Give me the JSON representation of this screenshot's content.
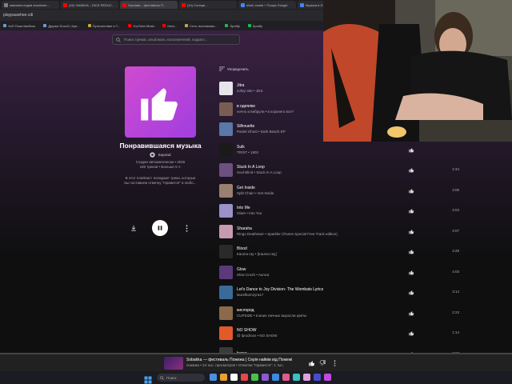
{
  "browser": {
    "tabs": [
      {
        "label": "ованием лидов значение...",
        "color": "#7f7f86"
      },
      {
        "label": "(16) YAMAHA – DICE REDUCT...",
        "color": "#ff0000"
      },
      {
        "label": "Hondata – фестиваль П...",
        "color": "#ff0000"
      },
      {
        "label": "(14) Солнце...",
        "color": "#ff0000"
      },
      {
        "label": "whaf–ткаев + Пошук Google",
        "color": "#4285f4"
      },
      {
        "label": "Музыка в Google dve Wahan...",
        "color": "#4285f4"
      },
      {
        "label": "Вечер...",
        "color": "#7f7f86"
      }
    ],
    "url": "playpauwhee.cdi",
    "bookmarks": [
      {
        "label": "УаП Пошт.Шаблон",
        "color": "#6b9bd1"
      },
      {
        "label": "Друзья Dnoo3 | Кри...",
        "color": "#6b9bd1"
      },
      {
        "label": "Путешествие в Т...",
        "color": "#c9a14a"
      },
      {
        "label": "YouTube Music",
        "color": "#ff0000"
      },
      {
        "label": "Ham...",
        "color": "#ff0000"
      },
      {
        "label": "Сеть: виставляю...",
        "color": "#c9a14a"
      },
      {
        "label": "Spotify",
        "color": "#1db954"
      },
      {
        "label": "Spotify",
        "color": "#1db954"
      }
    ]
  },
  "search": {
    "placeholder": "Поиск треков, альбомов, исполнителей, подкаст..."
  },
  "playlist": {
    "title": "Понравившаяся музыка",
    "owner": "Sayviod",
    "meta_line1": "Создан автоматически • 2026",
    "meta_line2": "180 треков • Больше 5 ч.",
    "desc_line1": "В этот плейлист попадают треки, которые",
    "desc_line2": "вы поставили отметку \"Нравится\" в любо..."
  },
  "sort_label": "Упорядочить",
  "tracks": [
    {
      "title": "Jitra",
      "sub": "sofsyi site • Jitra",
      "duration": "",
      "thumb": "#e5e5ea"
    },
    {
      "title": "в одеялке",
      "sub": "ночно и вибрули • в корзинго все?",
      "duration": "",
      "thumb": "#7a5d52"
    },
    {
      "title": "Silhouette",
      "sub": "Pastel Ghost • Dark Beach EP",
      "duration": "",
      "thumb": "#5a78a8"
    },
    {
      "title": "Sulk",
      "sub": "TR/ST • 1802",
      "duration": "",
      "thumb": "#1a1a1a"
    },
    {
      "title": "Stuck In A Loop",
      "sub": "Soul Blind • Stuck In A Loop",
      "duration": "2:34",
      "thumb": "#6b5080"
    },
    {
      "title": "Get Inside",
      "sub": "Split Chain • Get Inside",
      "duration": "3:05",
      "thumb": "#9a8070"
    },
    {
      "title": "Into Me",
      "sub": "Glare • Into You",
      "duration": "2:04",
      "thumb": "#9a92c8"
    },
    {
      "title": "Sharaha",
      "sub": "Ringo Deathstarr • Sparkler (iTunes Special Free Track edition)",
      "duration": "2:07",
      "thumb": "#c89ab0"
    },
    {
      "title": "Blood",
      "sub": "trauma ray • [trauma ray]",
      "duration": "4:28",
      "thumb": "#2a2a2a"
    },
    {
      "title": "Glow",
      "sub": "Slow Crush • Aurora",
      "duration": "4:03",
      "thumb": "#5a3a7a"
    },
    {
      "title": "Let's Dance to Joy Division- The Wombats Lyrics",
      "sub": "laurelbomzyra17",
      "duration": "3:14",
      "thumb": "#3a6a9a"
    },
    {
      "title": "кислород",
      "sub": "CUPSIZE • в моих личных выросли цветы",
      "duration": "2:23",
      "thumb": "#8a6a4a"
    },
    {
      "title": "NO SHOW",
      "sub": "@ lprodroxs • NO SHOW",
      "duration": "1:14",
      "thumb": "#e05a2a"
    },
    {
      "title": "hyper",
      "sub": "",
      "duration": "2:07",
      "thumb": "#3a3a3a"
    }
  ],
  "now_playing": {
    "title": "Sobakka — фестиваль Пожежа | Серія найвів від Пожежі",
    "sub": "пожежа • 24 тыс. просмотров • Отметки \"Нравится\": 1 тыс.",
    "progress": 0.0
  },
  "taskbar": {
    "search_label": "Поиск",
    "icons": [
      "#4a90e2",
      "#e8a030",
      "#ffffff",
      "#e04a4a",
      "#4ac04a",
      "#8a5ad0",
      "#3a8ae0",
      "#e05a8a",
      "#3ac0c0",
      "#e0a0e0",
      "#4a4ad0",
      "#c04ae0"
    ]
  }
}
